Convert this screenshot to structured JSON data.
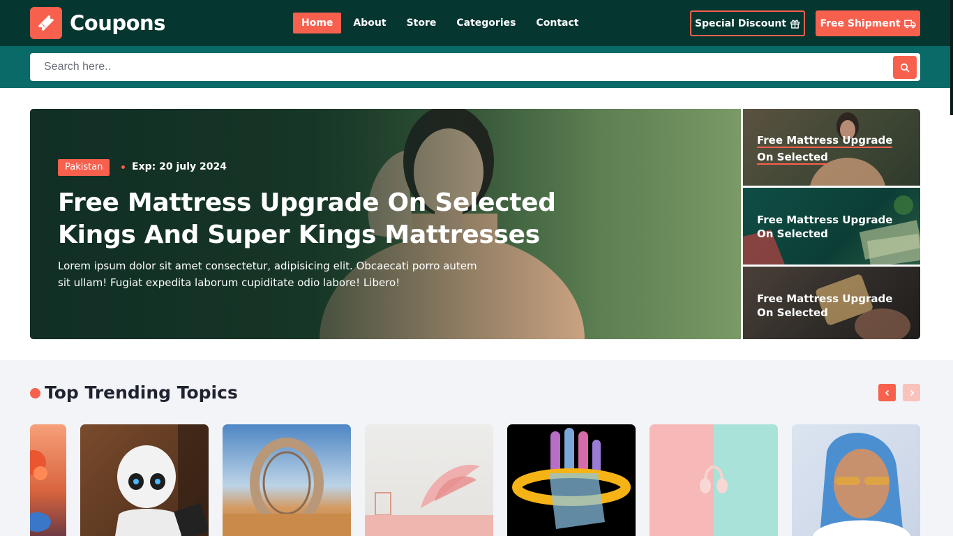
{
  "header": {
    "brand": "Coupons",
    "nav": [
      {
        "label": "Home",
        "active": true
      },
      {
        "label": "About"
      },
      {
        "label": "Store"
      },
      {
        "label": "Categories"
      },
      {
        "label": "Contact"
      }
    ],
    "special_discount_label": "Special Discount",
    "free_shipment_label": "Free Shipment"
  },
  "search": {
    "placeholder": "Search here.."
  },
  "hero": {
    "tag": "Pakistan",
    "expiry": "Exp: 20 july 2024",
    "title": "Free Mattress Upgrade On Selected Kings And Super Kings Mattresses",
    "description": "Lorem ipsum dolor sit amet consectetur, adipisicing elit. Obcaecati porro autem sit ullam! Fugiat expedita laborum cupiditate odio labore! Libero!"
  },
  "side_cards": [
    {
      "title": "Free Mattress Upgrade On Selected"
    },
    {
      "title": "Free Mattress Upgrade On Selected"
    },
    {
      "title": "Free Mattress Upgrade On Selected"
    }
  ],
  "trending": {
    "title": "Top Trending Topics",
    "cards": [
      {
        "icon": "flower-image"
      },
      {
        "icon": "robot-image"
      },
      {
        "icon": "ring-sculpture-image"
      },
      {
        "icon": "feather-decor-image"
      },
      {
        "icon": "holographic-hand-image"
      },
      {
        "icon": "headphones-image"
      },
      {
        "icon": "blue-hair-woman-image"
      }
    ]
  },
  "colors": {
    "accent": "#f8604e",
    "header_bg": "#053630",
    "search_bg": "#0a6a67"
  }
}
